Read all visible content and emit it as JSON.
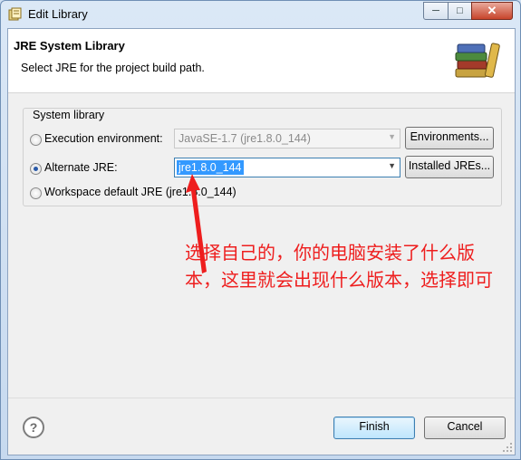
{
  "window": {
    "title": "Edit Library",
    "minimize_glyph": "─",
    "maximize_glyph": "□",
    "close_glyph": "✕"
  },
  "header": {
    "title": "JRE System Library",
    "description": "Select JRE for the project build path.",
    "icon": "library-books-icon"
  },
  "group": {
    "label": "System library",
    "execution_env": {
      "label": "Execution environment:",
      "value": "JavaSE-1.7 (jre1.8.0_144)",
      "button": "Environments...",
      "selected": false
    },
    "alternate_jre": {
      "label": "Alternate JRE:",
      "value": "jre1.8.0_144",
      "button": "Installed JREs...",
      "selected": true
    },
    "workspace_default": {
      "label": "Workspace default JRE (jre1.8.0_144)",
      "selected": false
    }
  },
  "annotation": {
    "line1": "选择自己的，你的电脑安装了什么版",
    "line2": "本，这里就会出现什么版本，选择即可",
    "color": "#ee1e1e"
  },
  "footer": {
    "help_glyph": "?",
    "finish": "Finish",
    "cancel": "Cancel"
  },
  "colors": {
    "accent": "#3c7fb1",
    "selection": "#3399ff"
  }
}
